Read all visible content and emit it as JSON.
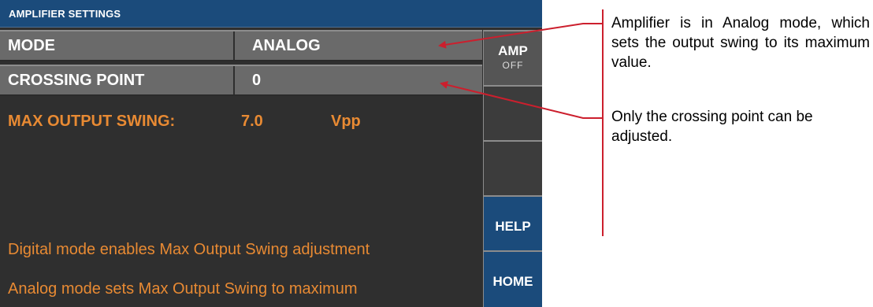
{
  "header": {
    "title": "AMPLIFIER SETTINGS"
  },
  "settings": {
    "mode": {
      "label": "MODE",
      "value": "ANALOG"
    },
    "crossing": {
      "label": "CROSSING POINT",
      "value": "0"
    }
  },
  "max_output": {
    "label": "MAX OUTPUT SWING:",
    "value": "7.0",
    "unit": "Vpp"
  },
  "notes": [
    "Digital mode enables Max Output Swing adjustment",
    "Analog mode sets Max Output Swing to maximum"
  ],
  "sidebar": {
    "amp_label": "AMP",
    "amp_state": "OFF",
    "help_label": "HELP",
    "home_label": "HOME"
  },
  "callouts": [
    "Amplifier is in Analog mode, which sets the output swing to its maximum value.",
    "Only the crossing point can be adjusted."
  ],
  "colors": {
    "title_bar": "#1b4b7b",
    "screen_bg": "#2f2f2f",
    "row_bg": "#6a6a6a",
    "accent_orange": "#e88a33",
    "arrow_red": "#cc1f2d"
  }
}
